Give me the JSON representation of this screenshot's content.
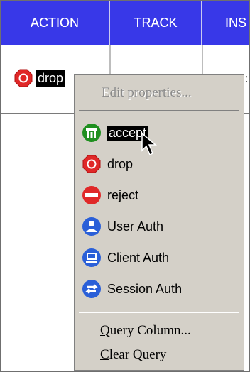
{
  "columns": [
    "ACTION",
    "TRACK",
    "INS"
  ],
  "row": {
    "action_label": "drop",
    "right_glyph": ":"
  },
  "context_menu": {
    "edit_properties": "Edit properties...",
    "actions": [
      {
        "label": "accept",
        "icon": "accept-icon",
        "color": "#1f8f1f",
        "selected": true
      },
      {
        "label": "drop",
        "icon": "drop-icon",
        "color": "#e02828"
      },
      {
        "label": "reject",
        "icon": "reject-icon",
        "color": "#e02828"
      },
      {
        "label": "User Auth",
        "icon": "user-auth-icon",
        "color": "#2a5fd8"
      },
      {
        "label": "Client Auth",
        "icon": "client-auth-icon",
        "color": "#2a5fd8"
      },
      {
        "label": "Session Auth",
        "icon": "session-auth-icon",
        "color": "#2a5fd8"
      }
    ],
    "query_column_first": "Q",
    "query_column_rest": "uery Column...",
    "clear_query_first": "C",
    "clear_query_rest": "lear Query"
  },
  "colors": {
    "header_bg": "#3838e8",
    "menu_bg": "#d4d0c8"
  }
}
